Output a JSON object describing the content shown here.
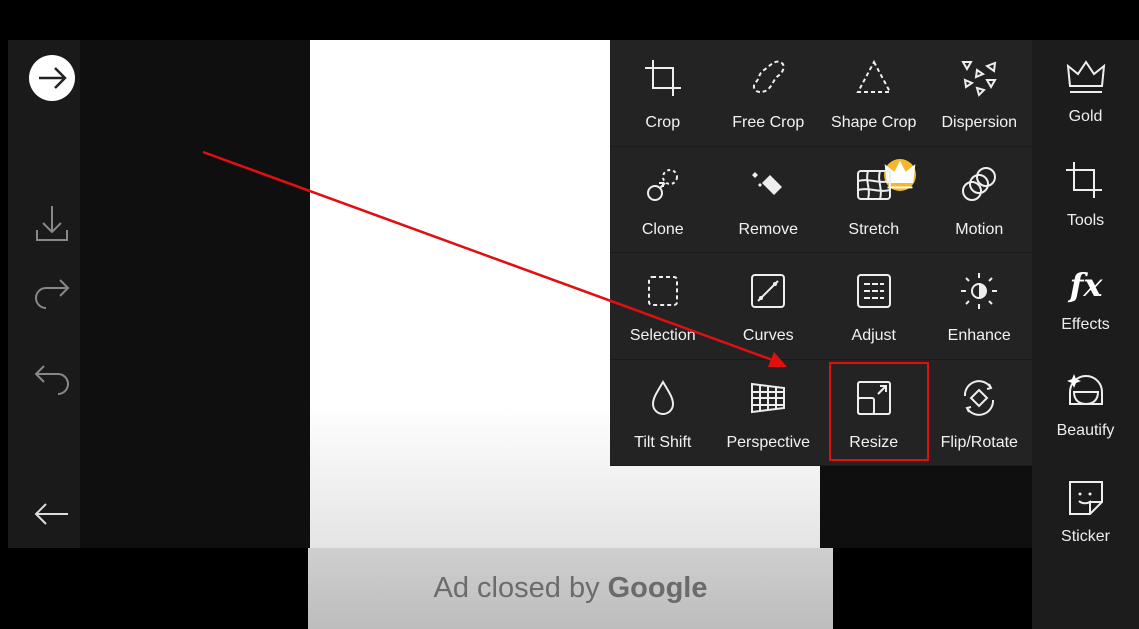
{
  "left_toolbar": {
    "items": [
      {
        "icon": "arrow-right-circle-icon"
      },
      {
        "icon": "download-icon"
      },
      {
        "icon": "redo-icon"
      },
      {
        "icon": "undo-icon"
      },
      {
        "icon": "back-arrow-icon"
      }
    ]
  },
  "tools_menu": {
    "items": [
      {
        "label": "Crop",
        "icon": "crop-icon"
      },
      {
        "label": "Free Crop",
        "icon": "free-crop-icon"
      },
      {
        "label": "Shape Crop",
        "icon": "shape-crop-icon"
      },
      {
        "label": "Dispersion",
        "icon": "dispersion-icon"
      },
      {
        "label": "Clone",
        "icon": "clone-icon"
      },
      {
        "label": "Remove",
        "icon": "eraser-icon",
        "premium": true
      },
      {
        "label": "Stretch",
        "icon": "stretch-icon"
      },
      {
        "label": "Motion",
        "icon": "motion-icon"
      },
      {
        "label": "Selection",
        "icon": "selection-icon"
      },
      {
        "label": "Curves",
        "icon": "curves-icon"
      },
      {
        "label": "Adjust",
        "icon": "adjust-icon"
      },
      {
        "label": "Enhance",
        "icon": "enhance-icon"
      },
      {
        "label": "Tilt Shift",
        "icon": "drop-icon"
      },
      {
        "label": "Perspective",
        "icon": "perspective-icon"
      },
      {
        "label": "Resize",
        "icon": "resize-icon",
        "highlighted": true
      },
      {
        "label": "Flip/Rotate",
        "icon": "flip-rotate-icon"
      }
    ]
  },
  "right_sidebar": {
    "items": [
      {
        "label": "Gold",
        "icon": "crown-icon"
      },
      {
        "label": "Tools",
        "icon": "crop-icon"
      },
      {
        "label": "Effects",
        "icon": "fx-icon"
      },
      {
        "label": "Beautify",
        "icon": "face-icon"
      },
      {
        "label": "Sticker",
        "icon": "sticker-icon"
      }
    ]
  },
  "ad": {
    "text": "Ad closed by",
    "brand": "Google"
  },
  "colors": {
    "annotation": "#e01010",
    "premium_badge": "#f4b82a",
    "panel": "#232323"
  }
}
